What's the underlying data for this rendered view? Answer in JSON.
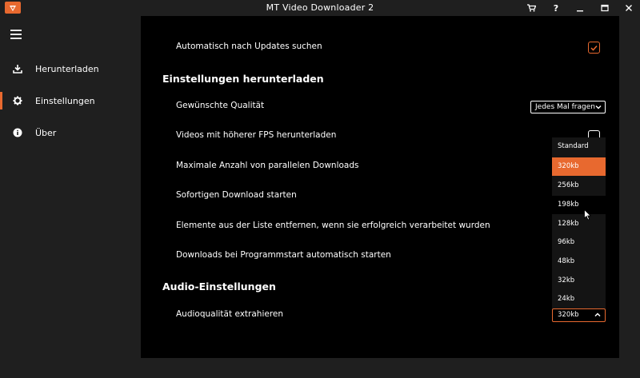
{
  "window": {
    "title": "MT Video Downloader 2"
  },
  "sidebar": {
    "items": [
      {
        "label": "Herunterladen",
        "icon": "download-icon"
      },
      {
        "label": "Einstellungen",
        "icon": "gear-icon"
      },
      {
        "label": "Über",
        "icon": "info-icon"
      }
    ],
    "active_index": 1
  },
  "settings": {
    "auto_update": {
      "label": "Automatisch nach Updates suchen",
      "checked": true
    },
    "download_section": "Einstellungen herunterladen",
    "quality": {
      "label": "Gewünschte Qualität",
      "value": "Jedes Mal fragen"
    },
    "high_fps": {
      "label": "Videos mit höherer FPS herunterladen"
    },
    "parallel": {
      "label": "Maximale Anzahl von parallelen Downloads"
    },
    "instant": {
      "label": "Sofortigen Download starten"
    },
    "remove_items": {
      "label": "Elemente aus der Liste entfernen, wenn sie erfolgreich verarbeitet wurden"
    },
    "autostart": {
      "label": "Downloads bei Programmstart automatisch starten"
    },
    "audio_section": "Audio-Einstellungen",
    "audio_quality": {
      "label": "Audioqualität extrahieren",
      "value": "320kb",
      "options": [
        "Standard",
        "320kb",
        "256kb",
        "198kb",
        "128kb",
        "96kb",
        "48kb",
        "32kb",
        "24kb"
      ],
      "selected_index": 1,
      "hovered_index": 3
    }
  },
  "colors": {
    "accent": "#e8692f",
    "main_bg": "#000000",
    "chrome_bg": "#1f1f1f"
  }
}
